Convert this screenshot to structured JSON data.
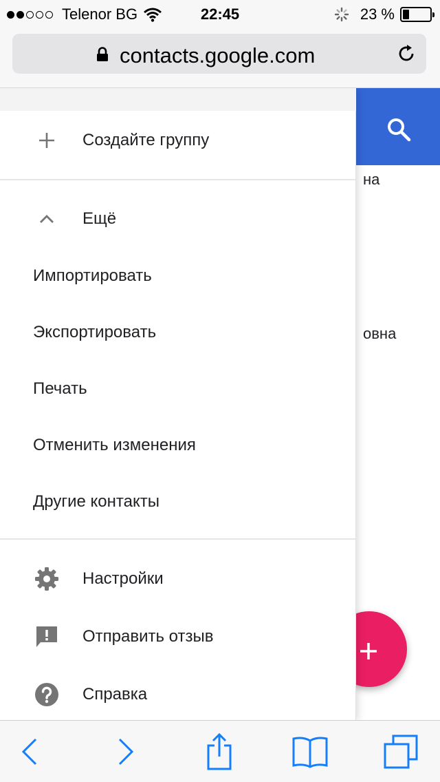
{
  "status_bar": {
    "carrier": "Telenor BG",
    "signal_bars_filled": 2,
    "signal_bars_total": 5,
    "time": "22:45",
    "battery_percent": "23 %",
    "battery_level": 0.23
  },
  "browser": {
    "url": "contacts.google.com"
  },
  "background_app": {
    "name_fragments": [
      "на",
      "овна"
    ],
    "accent_color": "#3367d6",
    "fab_color": "#e91e63"
  },
  "drawer": {
    "create_group_label": "Создайте группу",
    "more_label": "Ещё",
    "more_items": [
      "Импортировать",
      "Экспортировать",
      "Печать",
      "Отменить изменения",
      "Другие контакты"
    ],
    "settings_label": "Настройки",
    "feedback_label": "Отправить отзыв",
    "help_label": "Справка"
  },
  "icons": {
    "create_group": "plus-icon",
    "more": "chevron-up-icon",
    "settings": "gear-icon",
    "feedback": "feedback-icon",
    "help": "help-icon",
    "search": "search-icon",
    "fab": "plus-icon"
  },
  "colors": {
    "safari_blue": "#147efb",
    "icon_gray": "#757575",
    "text": "#202124"
  }
}
